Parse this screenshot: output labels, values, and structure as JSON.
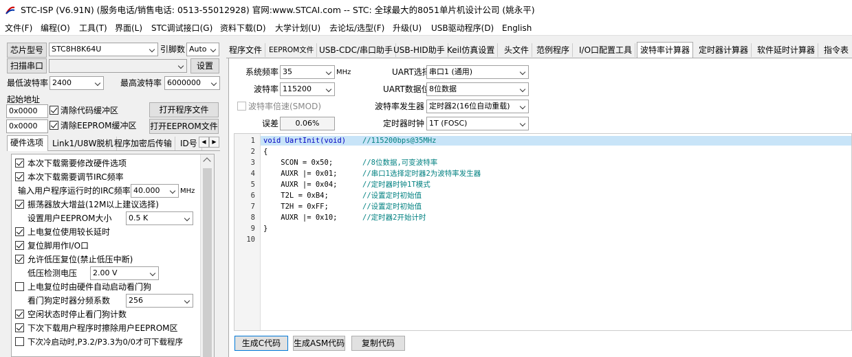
{
  "window": {
    "title": "STC-ISP (V6.91N) (服务电话/销售电话: 0513-55012928) 官网:www.STCAI.com  -- STC: 全球最大的8051单片机设计公司 (姚永平)"
  },
  "menu": [
    "文件(F)",
    "编程(O)",
    "工具(T)",
    "界面(L)",
    "STC调试接口(G)",
    "资料下载(D)",
    "大学计划(U)",
    "去论坛/选型(F)",
    "升级(U)",
    "USB驱动程序(D)",
    "English"
  ],
  "left": {
    "chip_label": "芯片型号",
    "chip_value": "STC8H8K64U",
    "pin_label": "引脚数",
    "pin_value": "Auto",
    "scan_button": "扫描串口",
    "port_value": "",
    "settings_button": "设置",
    "min_baud_label": "最低波特率",
    "min_baud_value": "2400",
    "max_baud_label": "最高波特率",
    "max_baud_value": "6000000",
    "start_addr_label": "起始地址",
    "addr1": "0x0000",
    "clear_code": "清除代码缓冲区",
    "open_prog": "打开程序文件",
    "addr2": "0x0000",
    "clear_eeprom": "清除EEPROM缓冲区",
    "open_eeprom": "打开EEPROM文件",
    "tabs": [
      "硬件选项",
      "Link1/U8W脱机",
      "程序加密后传输",
      "ID号"
    ],
    "opts": {
      "o1": "本次下载需要修改硬件选项",
      "o2": "本次下载需要调节IRC频率",
      "irc_label": "输入用户程序运行时的IRC频率",
      "irc_value": "40.000",
      "irc_unit": "MHz",
      "o3": "振荡器放大增益(12M以上建议选择)",
      "eeprom_label": "设置用户EEPROM大小",
      "eeprom_value": "0.5 K",
      "o4": "上电复位使用较长延时",
      "o5": "复位脚用作I/O口",
      "o6": "允许低压复位(禁止低压中断)",
      "lv_label": "低压检测电压",
      "lv_value": "2.00 V",
      "o7": "上电复位时由硬件自动启动看门狗",
      "wdt_label": "看门狗定时器分频系数",
      "wdt_value": "256",
      "o8": "空闲状态时停止看门狗计数",
      "o9": "下次下载用户程序时擦除用户EEPROM区",
      "o10": "下次冷启动时,P3.2/P3.3为0/0才可下载程序"
    }
  },
  "right": {
    "tabs": [
      "程序文件",
      "EEPROM文件",
      "USB-CDC/串口助手",
      "USB-HID助手",
      "Keil仿真设置",
      "头文件",
      "范例程序",
      "I/O口配置工具",
      "波特率计算器",
      "定时器计算器",
      "软件延时计算器",
      "指令表"
    ],
    "sysfreq_label": "系统频率",
    "sysfreq_value": "35",
    "sysfreq_unit": "MHz",
    "baud_label": "波特率",
    "baud_value": "115200",
    "smod_label": "波特率倍速(SMOD)",
    "err_label": "误差",
    "err_value": "0.06%",
    "uart_sel_label": "UART选择",
    "uart_sel_value": "串口1 (通用)",
    "uart_bits_label": "UART数据位",
    "uart_bits_value": "8位数据",
    "baudgen_label": "波特率发生器",
    "baudgen_value": "定时器2(16位自动重载)",
    "tclk_label": "定时器时钟",
    "tclk_value": "1T  (FOSC)",
    "code_lines": [
      {
        "n": "1",
        "code": "void UartInit(void)",
        "cmt": "//115200bps@35MHz"
      },
      {
        "n": "2",
        "code": "{",
        "cmt": ""
      },
      {
        "n": "3",
        "code": "    SCON = 0x50;",
        "cmt": "//8位数据,可变波特率"
      },
      {
        "n": "4",
        "code": "    AUXR |= 0x01;",
        "cmt": "//串口1选择定时器2为波特率发生器"
      },
      {
        "n": "5",
        "code": "    AUXR |= 0x04;",
        "cmt": "//定时器时钟1T模式"
      },
      {
        "n": "6",
        "code": "    T2L = 0xB4;",
        "cmt": "//设置定时初始值"
      },
      {
        "n": "7",
        "code": "    T2H = 0xFF;",
        "cmt": "//设置定时初始值"
      },
      {
        "n": "8",
        "code": "    AUXR |= 0x10;",
        "cmt": "//定时器2开始计时"
      },
      {
        "n": "9",
        "code": "}",
        "cmt": ""
      },
      {
        "n": "10",
        "code": "",
        "cmt": ""
      }
    ],
    "gen_c": "生成C代码",
    "gen_asm": "生成ASM代码",
    "copy": "复制代码"
  },
  "colors": {
    "keyword": "#0000c0",
    "comment": "#008080",
    "highlight": "#c8e4f8"
  }
}
